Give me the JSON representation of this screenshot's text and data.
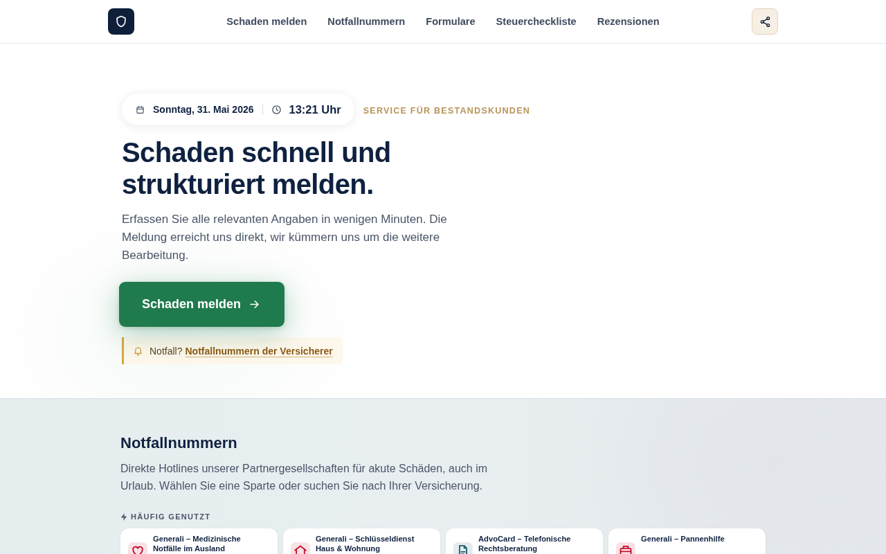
{
  "header": {
    "nav": [
      "Schaden melden",
      "Notfallnummern",
      "Formulare",
      "Steuercheckliste",
      "Rezensionen"
    ]
  },
  "hero": {
    "date": "Sonntag, 31. Mai 2026",
    "time": "13:21 Uhr",
    "eyebrow": "SERVICE FÜR BESTANDSKUNDEN",
    "title": "Schaden schnell und strukturiert melden.",
    "description": "Erfassen Sie alle relevanten Angaben in wenigen Minuten. Die Meldung erreicht uns direkt, wir kümmern uns um die weitere Bearbeitung.",
    "cta": "Schaden melden",
    "notice": {
      "label": "Notfall?",
      "link": "Notfallnummern der Versicherer"
    }
  },
  "hotlines": {
    "title": "Notfallnummern",
    "description": "Direkte Hotlines unserer Partnergesellschaften für akute Schäden, auch im Urlaub. Wählen Sie eine Sparte oder suchen Sie nach Ihrer Versicherung.",
    "frequent_label": "HÄUFIG GENUTZT",
    "cards": [
      {
        "kind": "medical",
        "color": "#c8102e",
        "title": "Generali – Medizinische Notfälle im Ausland"
      },
      {
        "kind": "home",
        "color": "#c8102e",
        "title": "Generali – Schlüsseldienst Haus & Wohnung"
      },
      {
        "kind": "legal",
        "color": "#1d5c6b",
        "title": "AdvoCard – Telefonische Rechtsberatung"
      },
      {
        "kind": "roadside",
        "color": "#c8102e",
        "title": "Generali – Pannenhilfe"
      }
    ]
  }
}
